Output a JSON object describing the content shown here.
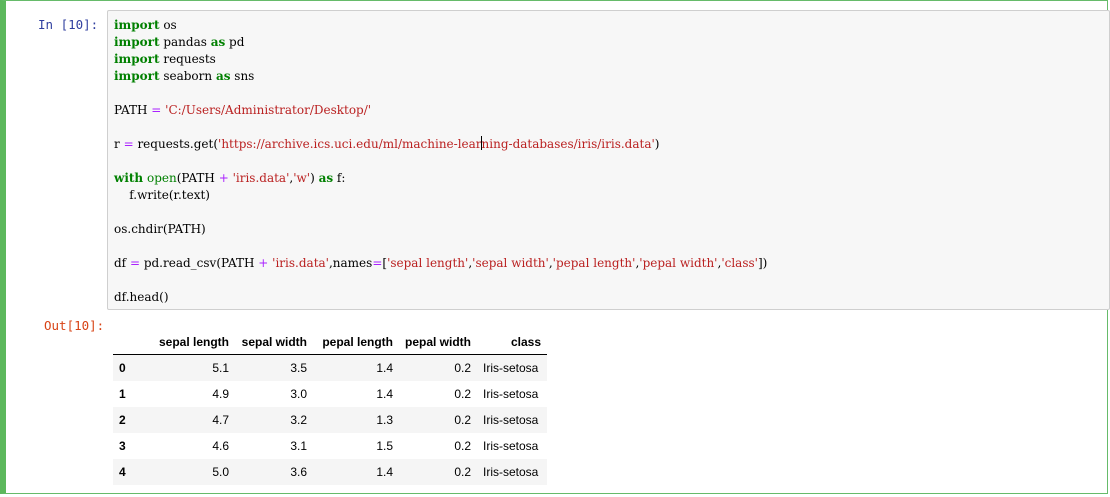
{
  "cell": {
    "input_prompt": "In  [10]:",
    "output_prompt": "Out[10]:"
  },
  "code": {
    "lines": [
      "import os",
      "import pandas as pd",
      "import requests",
      "import seaborn as sns",
      "",
      "PATH = 'C:/Users/Administrator/Desktop/'",
      "",
      "r = requests.get('https://archive.ics.uci.edu/ml/machine-learning-databases/iris/iris.data')",
      "",
      "with open(PATH + 'iris.data','w') as f:",
      "    f.write(r.text)",
      "",
      "os.chdir(PATH)",
      "",
      "df = pd.read_csv(PATH + 'iris.data',names=['sepal length','sepal width','pepal length','pepal width','class'])",
      "",
      "df.head()"
    ]
  },
  "table": {
    "columns": [
      "",
      "sepal length",
      "sepal width",
      "pepal length",
      "pepal width",
      "class"
    ],
    "rows": [
      [
        "0",
        "5.1",
        "3.5",
        "1.4",
        "0.2",
        "Iris-setosa"
      ],
      [
        "1",
        "4.9",
        "3.0",
        "1.4",
        "0.2",
        "Iris-setosa"
      ],
      [
        "2",
        "4.7",
        "3.2",
        "1.3",
        "0.2",
        "Iris-setosa"
      ],
      [
        "3",
        "4.6",
        "3.1",
        "1.5",
        "0.2",
        "Iris-setosa"
      ],
      [
        "4",
        "5.0",
        "3.6",
        "1.4",
        "0.2",
        "Iris-setosa"
      ]
    ]
  },
  "colors": {
    "cell_border": "#5cb85c",
    "input_prompt": "#303f9f",
    "output_prompt": "#d84315",
    "keyword": "#008000",
    "string": "#ba2121",
    "operator": "#aa22ff"
  }
}
